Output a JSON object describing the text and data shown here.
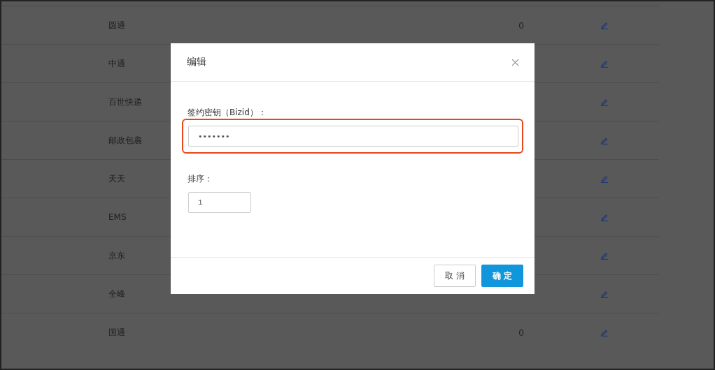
{
  "table": {
    "rows": [
      {
        "name": "圆通",
        "count": "0"
      },
      {
        "name": "中通"
      },
      {
        "name": "百世快递"
      },
      {
        "name": "邮政包裹"
      },
      {
        "name": "天天"
      },
      {
        "name": "EMS"
      },
      {
        "name": "京东"
      },
      {
        "name": "全峰"
      },
      {
        "name": "国通",
        "count": "0"
      }
    ]
  },
  "dialog": {
    "title": "编辑",
    "fields": [
      {
        "label": "签约密钥（Bizid）：",
        "kind": "password",
        "value": "•••••••",
        "highlighted": true
      },
      {
        "label": "排序：",
        "kind": "number",
        "value": "1",
        "highlighted": false
      }
    ],
    "buttons": [
      {
        "label": "取 消",
        "kind": "secondary"
      },
      {
        "label": "确 定",
        "kind": "primary"
      }
    ]
  }
}
